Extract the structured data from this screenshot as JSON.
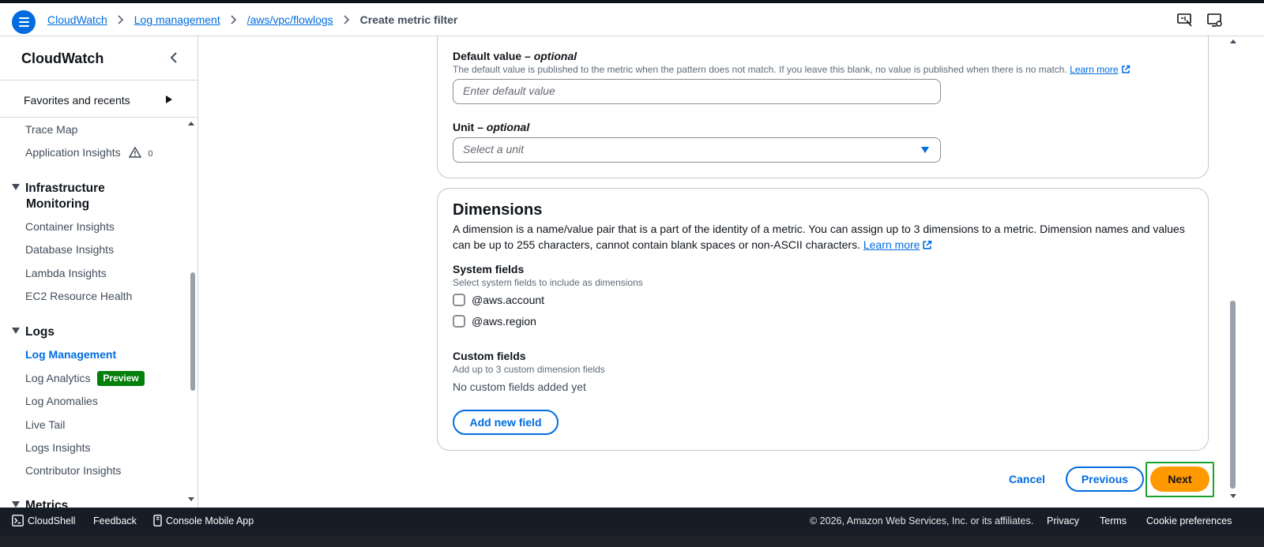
{
  "breadcrumb": {
    "items": [
      "CloudWatch",
      "Log management",
      "/aws/vpc/flowlogs"
    ],
    "current": "Create metric filter"
  },
  "header_icons": [
    "console-feedback-icon",
    "cloudshell-screen-icon"
  ],
  "sidebar": {
    "title": "CloudWatch",
    "favorites": "Favorites and recents",
    "items_top": [
      "Trace Map",
      "Application Insights"
    ],
    "app_insights_count": "0",
    "sections": [
      {
        "title_line1": "Infrastructure",
        "title_line2": "Monitoring",
        "items": [
          "Container Insights",
          "Database Insights",
          "Lambda Insights",
          "EC2 Resource Health"
        ]
      },
      {
        "title": "Logs",
        "items": [
          "Log Management",
          "Log Analytics",
          "Log Anomalies",
          "Live Tail",
          "Logs Insights",
          "Contributor Insights"
        ],
        "preview_badge": "Preview"
      },
      {
        "title": "Metrics"
      }
    ],
    "active_item": "Log Management"
  },
  "metric_details": {
    "default_value": {
      "label": "Default value – ",
      "label_optional": "optional",
      "description": "The default value is published to the metric when the pattern does not match. If you leave this blank, no value is published when there is no match.",
      "learn_more": "Learn more",
      "placeholder": "Enter default value"
    },
    "unit": {
      "label": "Unit – ",
      "label_optional": "optional",
      "placeholder": "Select a unit"
    }
  },
  "dimensions": {
    "heading": "Dimensions",
    "description_line1": "A dimension is a name/value pair that is a part of the identity of a metric. You can assign up to 3 dimensions to a metric. Dimension names and values",
    "description_line2": "can be up to 255 characters, cannot contain blank spaces or non-ASCII characters.",
    "learn_more": "Learn more",
    "system_fields_label": "System fields",
    "system_fields_desc": "Select system fields to include as dimensions",
    "checkboxes": [
      "@aws.account",
      "@aws.region"
    ],
    "custom_fields_label": "Custom fields",
    "custom_fields_desc": "Add up to 3 custom dimension fields",
    "no_custom": "No custom fields added yet",
    "add_button": "Add new field"
  },
  "actions": {
    "cancel": "Cancel",
    "previous": "Previous",
    "next": "Next"
  },
  "footer": {
    "cloudshell": "CloudShell",
    "feedback": "Feedback",
    "mobile_app": "Console Mobile App",
    "copyright": "© 2026, Amazon Web Services, Inc. or its affiliates.",
    "privacy": "Privacy",
    "terms": "Terms",
    "cookies": "Cookie preferences"
  },
  "colors": {
    "link": "#006ce0",
    "primary_button": "#ff9900",
    "preview_badge": "#037f0c",
    "highlight": "#1aa32a",
    "footer_bg": "#161d26"
  }
}
